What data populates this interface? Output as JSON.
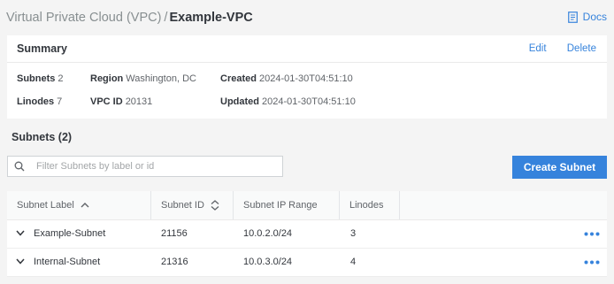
{
  "breadcrumb": {
    "root": "Virtual Private Cloud (VPC)",
    "separator": "/",
    "current": "Example-VPC"
  },
  "docs_label": "Docs",
  "summary": {
    "title": "Summary",
    "edit_label": "Edit",
    "delete_label": "Delete",
    "subnets_key": "Subnets",
    "subnets_value": "2",
    "linodes_key": "Linodes",
    "linodes_value": "7",
    "region_key": "Region",
    "region_value": "Washington, DC",
    "vpcid_key": "VPC ID",
    "vpcid_value": "20131",
    "created_key": "Created",
    "created_value": "2024-01-30T04:51:10",
    "updated_key": "Updated",
    "updated_value": "2024-01-30T04:51:10"
  },
  "subnets_section": {
    "title": "Subnets (2)",
    "filter_placeholder": "Filter Subnets by label or id",
    "filter_value": "",
    "create_label": "Create Subnet"
  },
  "table": {
    "headers": {
      "label": "Subnet Label",
      "id": "Subnet ID",
      "range": "Subnet IP Range",
      "linodes": "Linodes"
    },
    "rows": [
      {
        "label": "Example-Subnet",
        "id": "21156",
        "range": "10.0.2.0/24",
        "linodes": "3"
      },
      {
        "label": "Internal-Subnet",
        "id": "21316",
        "range": "10.0.3.0/24",
        "linodes": "4"
      }
    ]
  },
  "icons": {
    "docs": "docs-icon",
    "search": "search-icon",
    "sort_asc": "sort-ascending-icon",
    "sort_both": "sort-icon",
    "expand": "chevron-down-icon",
    "more": "more-actions-icon"
  },
  "colors": {
    "accent": "#3683dc",
    "background": "#f4f4f4",
    "panel": "#ffffff"
  }
}
